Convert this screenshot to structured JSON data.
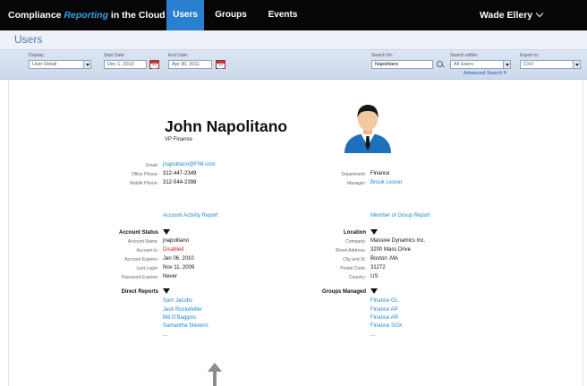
{
  "app": {
    "brand_pre": "Compliance ",
    "brand_accent": "Reporting",
    "brand_post": " in the Cloud",
    "user_name": "Wade Ellery",
    "colors": {
      "nav_bg": "#060606",
      "nav_active": "#2b7fd0",
      "accent": "#3aa0e6",
      "link": "#1f8ad4",
      "disabled": "#d31c1c"
    }
  },
  "nav": {
    "tabs": [
      "Users",
      "Groups",
      "Events"
    ],
    "active": "Users"
  },
  "page": {
    "title": "Users"
  },
  "filters": {
    "display_label": "Display:",
    "display_value": "User Detail",
    "start_label": "Start Date:",
    "start_value": "Dec 1, 2010",
    "end_label": "End Date:",
    "end_value": "Apr 30, 2011",
    "search_label": "Search for:",
    "search_value": "Napolitano",
    "within_label": "Search within:",
    "within_value": "All Users",
    "export_label": "Export to:",
    "export_value": "CSV",
    "advanced": "Advanced Search",
    "advanced_chevron": "¥"
  },
  "profile": {
    "name": "John Napolitano",
    "title": "VP Finance",
    "contact": [
      {
        "label": "Email:",
        "value": "jnapolitano@FIM.com",
        "link": true
      },
      {
        "label": "Office Phone:",
        "value": "312-447-2349",
        "link": false
      },
      {
        "label": "Mobile Phone:",
        "value": "312-544-2398",
        "link": false
      }
    ],
    "org": [
      {
        "label": "Department:",
        "value": "Finance",
        "link": false
      },
      {
        "label": "Manager:",
        "value": "Brook Lesner",
        "link": true
      }
    ],
    "activity_link": "Account Activity Report",
    "group_report_link": "Member of Group Report",
    "account": {
      "heading": "Account Status",
      "rows": [
        {
          "label": "Account Name:",
          "value": "jnapolitano",
          "red": false
        },
        {
          "label": "Account is:",
          "value": "Disabled",
          "red": true
        },
        {
          "label": "Account Expires:",
          "value": "Jan 06, 2010",
          "red": false
        },
        {
          "label": "Last Login:",
          "value": "Nov 11, 2009",
          "red": false
        },
        {
          "label": "Password Expires:",
          "value": "Never",
          "red": false
        }
      ]
    },
    "location": {
      "heading": "Location",
      "rows": [
        {
          "label": "Company:",
          "value": "Massive Dynamics Inc."
        },
        {
          "label": "Street Address:",
          "value": "3200 Mass Drive"
        },
        {
          "label": "City and St:",
          "value": "Boston ,MA"
        },
        {
          "label": "Postal Code:",
          "value": "31272"
        },
        {
          "label": "Country:",
          "value": "US"
        }
      ]
    },
    "direct_reports": {
      "heading": "Direct Reports",
      "items": [
        "Sam Jacobs",
        "Jack Rockefeller",
        "Bill O'Baggins",
        "Samantha Stevens"
      ],
      "more": "..."
    },
    "groups_managed": {
      "heading": "Groups Managed",
      "items": [
        "Finance GL",
        "Finance AP",
        "Finance AR",
        "Finance SOX"
      ],
      "more": "..."
    }
  }
}
